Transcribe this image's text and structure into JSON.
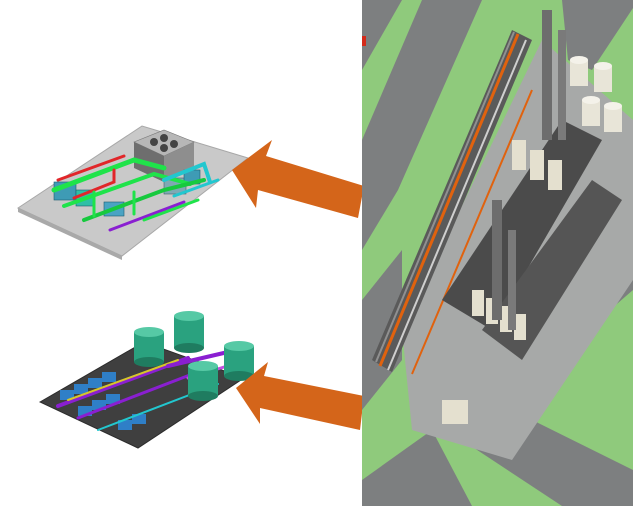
{
  "colors": {
    "arrow": "#d4651a",
    "grass": "#8fca7c",
    "road": "#7d7f80",
    "slab": "#c9c9c9",
    "dark_slab": "#3f3f3f",
    "pipe_green": "#1fe34a",
    "pipe_red": "#e1262a",
    "pipe_cyan": "#22c7cf",
    "tank_teal": "#2aa27f",
    "pipe_purple": "#8a1fd1",
    "pipe_orange": "#e0620e"
  },
  "icons": {
    "arrow_top": "arrow-left-icon",
    "arrow_bottom": "arrow-left-icon"
  }
}
